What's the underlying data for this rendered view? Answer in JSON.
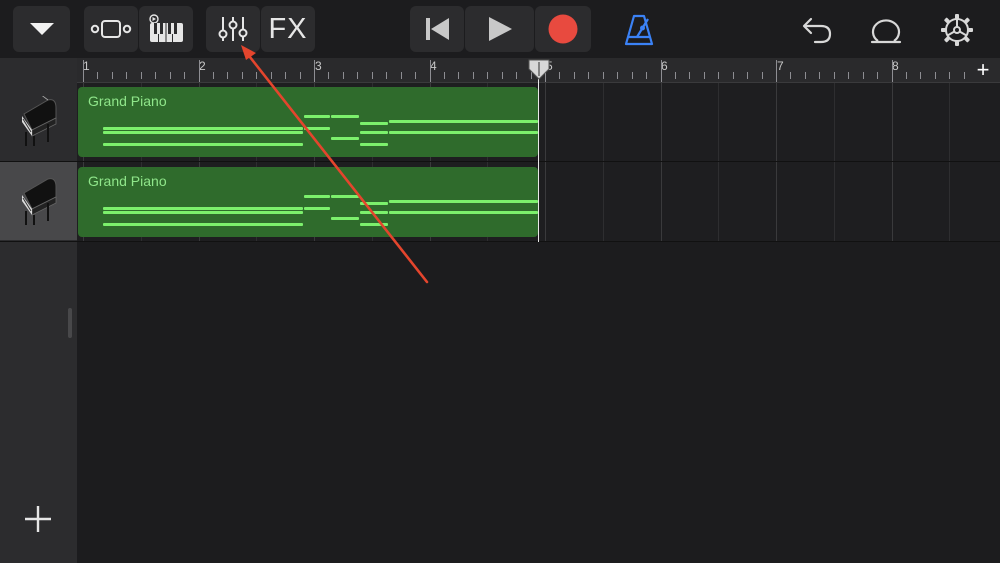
{
  "toolbar": {
    "fx_label": "FX"
  },
  "ruler": {
    "bars": [
      "1",
      "2",
      "3",
      "4",
      "5",
      "6",
      "7",
      "8"
    ],
    "add_section_label": "+"
  },
  "tracks": [
    {
      "instrument": "Grand Piano",
      "region_label": "Grand Piano"
    },
    {
      "instrument": "Grand Piano",
      "region_label": "Grand Piano"
    }
  ],
  "add_track_label": "+",
  "colors": {
    "region": "#2f6b2c",
    "notes": "#7cf06c",
    "record": "#e84a3f",
    "metronome": "#3b82f6",
    "annotation_arrow": "#e4452d"
  }
}
